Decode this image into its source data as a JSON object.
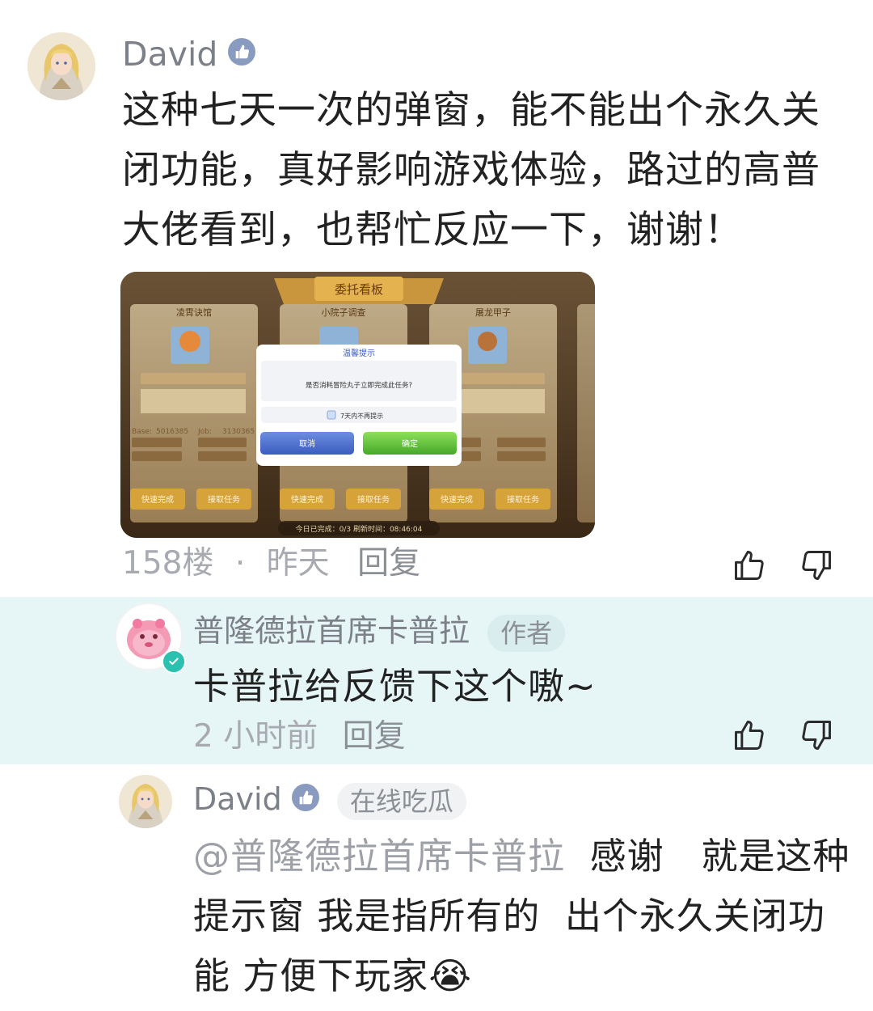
{
  "comment": {
    "author": "David",
    "text": "这种七天一次的弹窗，能不能出个永久关闭功能，真好影响游戏体验，路过的高普大佬看到，也帮忙反应一下，谢谢！",
    "floor": "158楼",
    "separator": "·",
    "time": "昨天",
    "reply_label": "回复",
    "screenshot": {
      "banner_title": "委托看板",
      "dialog_title": "温馨提示",
      "dialog_question": "是否消耗冒险丸子立即完成此任务?",
      "dialog_checkbox_label": "7天内不再提示",
      "dialog_cancel": "取消",
      "dialog_confirm": "确定",
      "card_names": [
        "凌霄诀馆",
        "小院子调查",
        "屠龙甲子"
      ],
      "base_label": "Base:",
      "base_value": "5016385",
      "job_label": "Job:",
      "job_value": "3130365",
      "quick_finish_label": "快速完成",
      "abandon_label": "接取任务",
      "footer_text": "今日已完成：0/3 刷新时间：08:46:04"
    }
  },
  "replies": [
    {
      "author": "普隆德拉首席卡普拉",
      "badge": "作者",
      "text": "卡普拉给反馈下这个嗷~",
      "time": "2 小时前",
      "reply_label": "回复"
    },
    {
      "author": "David",
      "badge": "在线吃瓜",
      "mention": "@普隆德拉首席卡普拉",
      "text": "  感谢   就是这种提示窗 我是指所有的  出个永久关闭功能 方便下玩家",
      "emoji": "😭"
    }
  ],
  "colors": {
    "highlight_bg": "#e6f6f7",
    "verified": "#8a9bc0",
    "meta_text": "#a7abb1"
  },
  "icons": [
    "verified-icon",
    "thumbs-up-icon",
    "thumbs-down-icon",
    "check-badge-icon"
  ]
}
